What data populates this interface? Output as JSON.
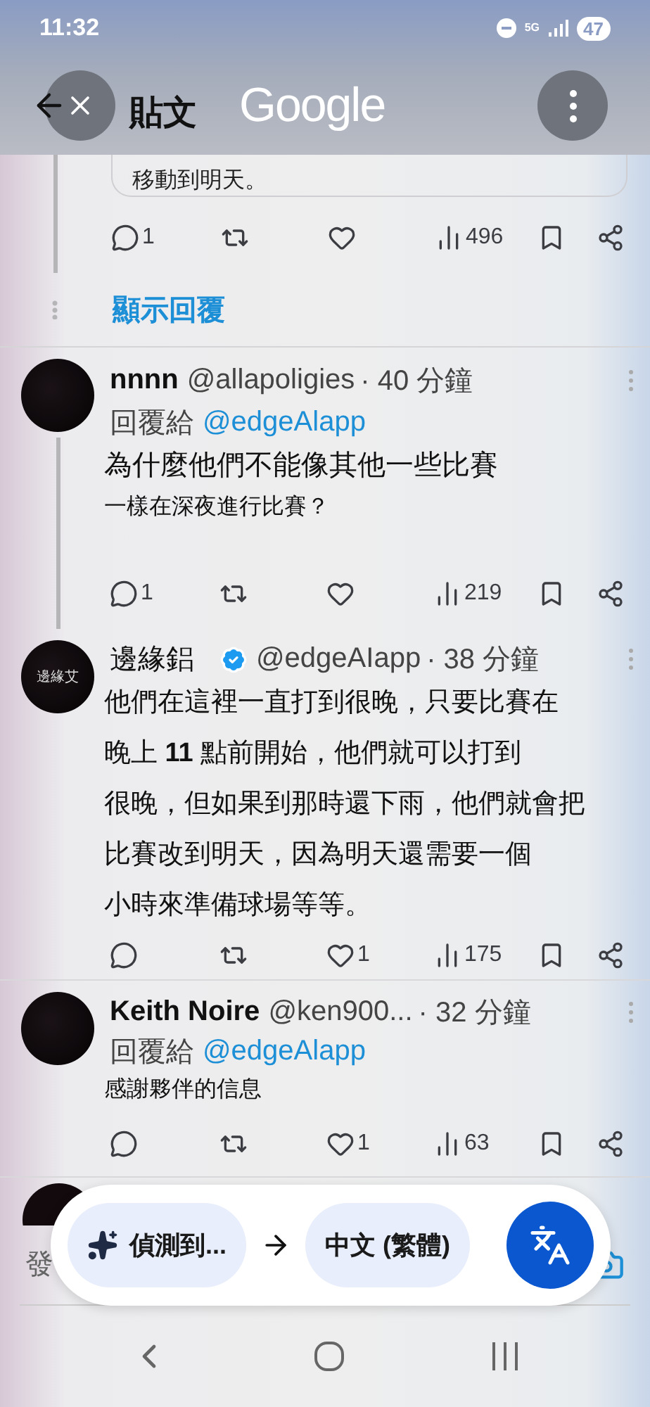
{
  "status_bar": {
    "time": "11:32",
    "network": "5G",
    "battery": "47"
  },
  "header": {
    "title": "貼文",
    "brand": "Google"
  },
  "quoted_tail": {
    "text": "移動到明天。",
    "actions": {
      "replies": "1",
      "views": "496"
    }
  },
  "show_replies": "顯示回覆",
  "tweets": [
    {
      "name": "nnnn",
      "handle": "@allapoligies",
      "time": "· 40 分鐘",
      "verified": false,
      "reply_prefix": "回覆給",
      "reply_to": "@edgeAlapp",
      "thread_line": true,
      "lines": [
        {
          "text": "為什麼他們不能像其他一些比賽",
          "kind": "large"
        },
        {
          "text": "一樣在深夜進行比賽？",
          "kind": "small"
        }
      ],
      "actions": {
        "replies": "1",
        "views": "219"
      }
    },
    {
      "name": "邊緣鋁",
      "handle": "@edgeAIapp",
      "time": "· 38 分鐘",
      "verified": true,
      "avatar_text": "邊緣艾",
      "thread_line": false,
      "lines": [
        {
          "text": "他們在這裡一直打到很晚，只要比賽在",
          "kind": "medium"
        },
        {
          "text": "晚上 **11** 點前開始，他們就可以打到",
          "kind": "medium"
        },
        {
          "text": "很晚，但如果到那時還下雨，他們就會把",
          "kind": "medium"
        },
        {
          "text": "比賽改到明天，因為明天還需要一個",
          "kind": "medium"
        },
        {
          "text": "小時來準備球場等等。",
          "kind": "medium"
        }
      ],
      "actions": {
        "likes": "1",
        "views": "175"
      }
    },
    {
      "name": "Keith Noire",
      "handle": "@ken900...",
      "time": "· 32 分鐘",
      "verified": false,
      "reply_prefix": "回覆給",
      "reply_to": "@edgeAlapp",
      "thread_line": false,
      "lines": [
        {
          "text": "感謝夥伴的信息",
          "kind": "small"
        }
      ],
      "actions": {
        "likes": "1",
        "views": "63"
      }
    }
  ],
  "compose": {
    "placeholder": "發"
  },
  "translate_bar": {
    "source": "偵測到...",
    "target": "中文 (繁體)"
  }
}
